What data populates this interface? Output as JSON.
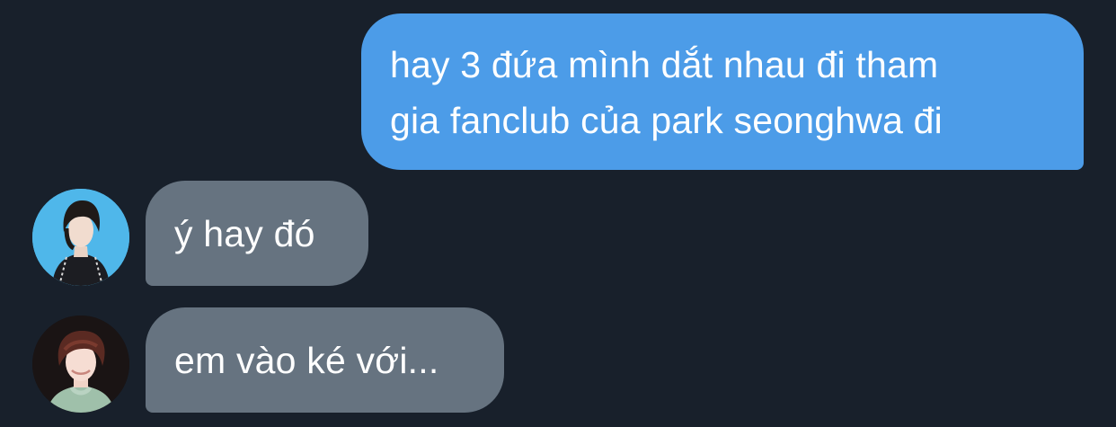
{
  "conversation": {
    "messages": [
      {
        "direction": "outgoing",
        "lines": [
          "hay 3 đứa mình dắt nhau đi tham",
          "gia fanclub của park seonghwa đi"
        ]
      },
      {
        "direction": "incoming",
        "text": "ý hay đó",
        "avatar": "avatar-blue-background"
      },
      {
        "direction": "incoming",
        "text": "em vào ké với...",
        "avatar": "avatar-dark-background"
      }
    ]
  },
  "colors": {
    "background": "#18202b",
    "outgoing_bubble": "#4c9ce8",
    "incoming_bubble": "#667380",
    "text": "#ffffff"
  }
}
